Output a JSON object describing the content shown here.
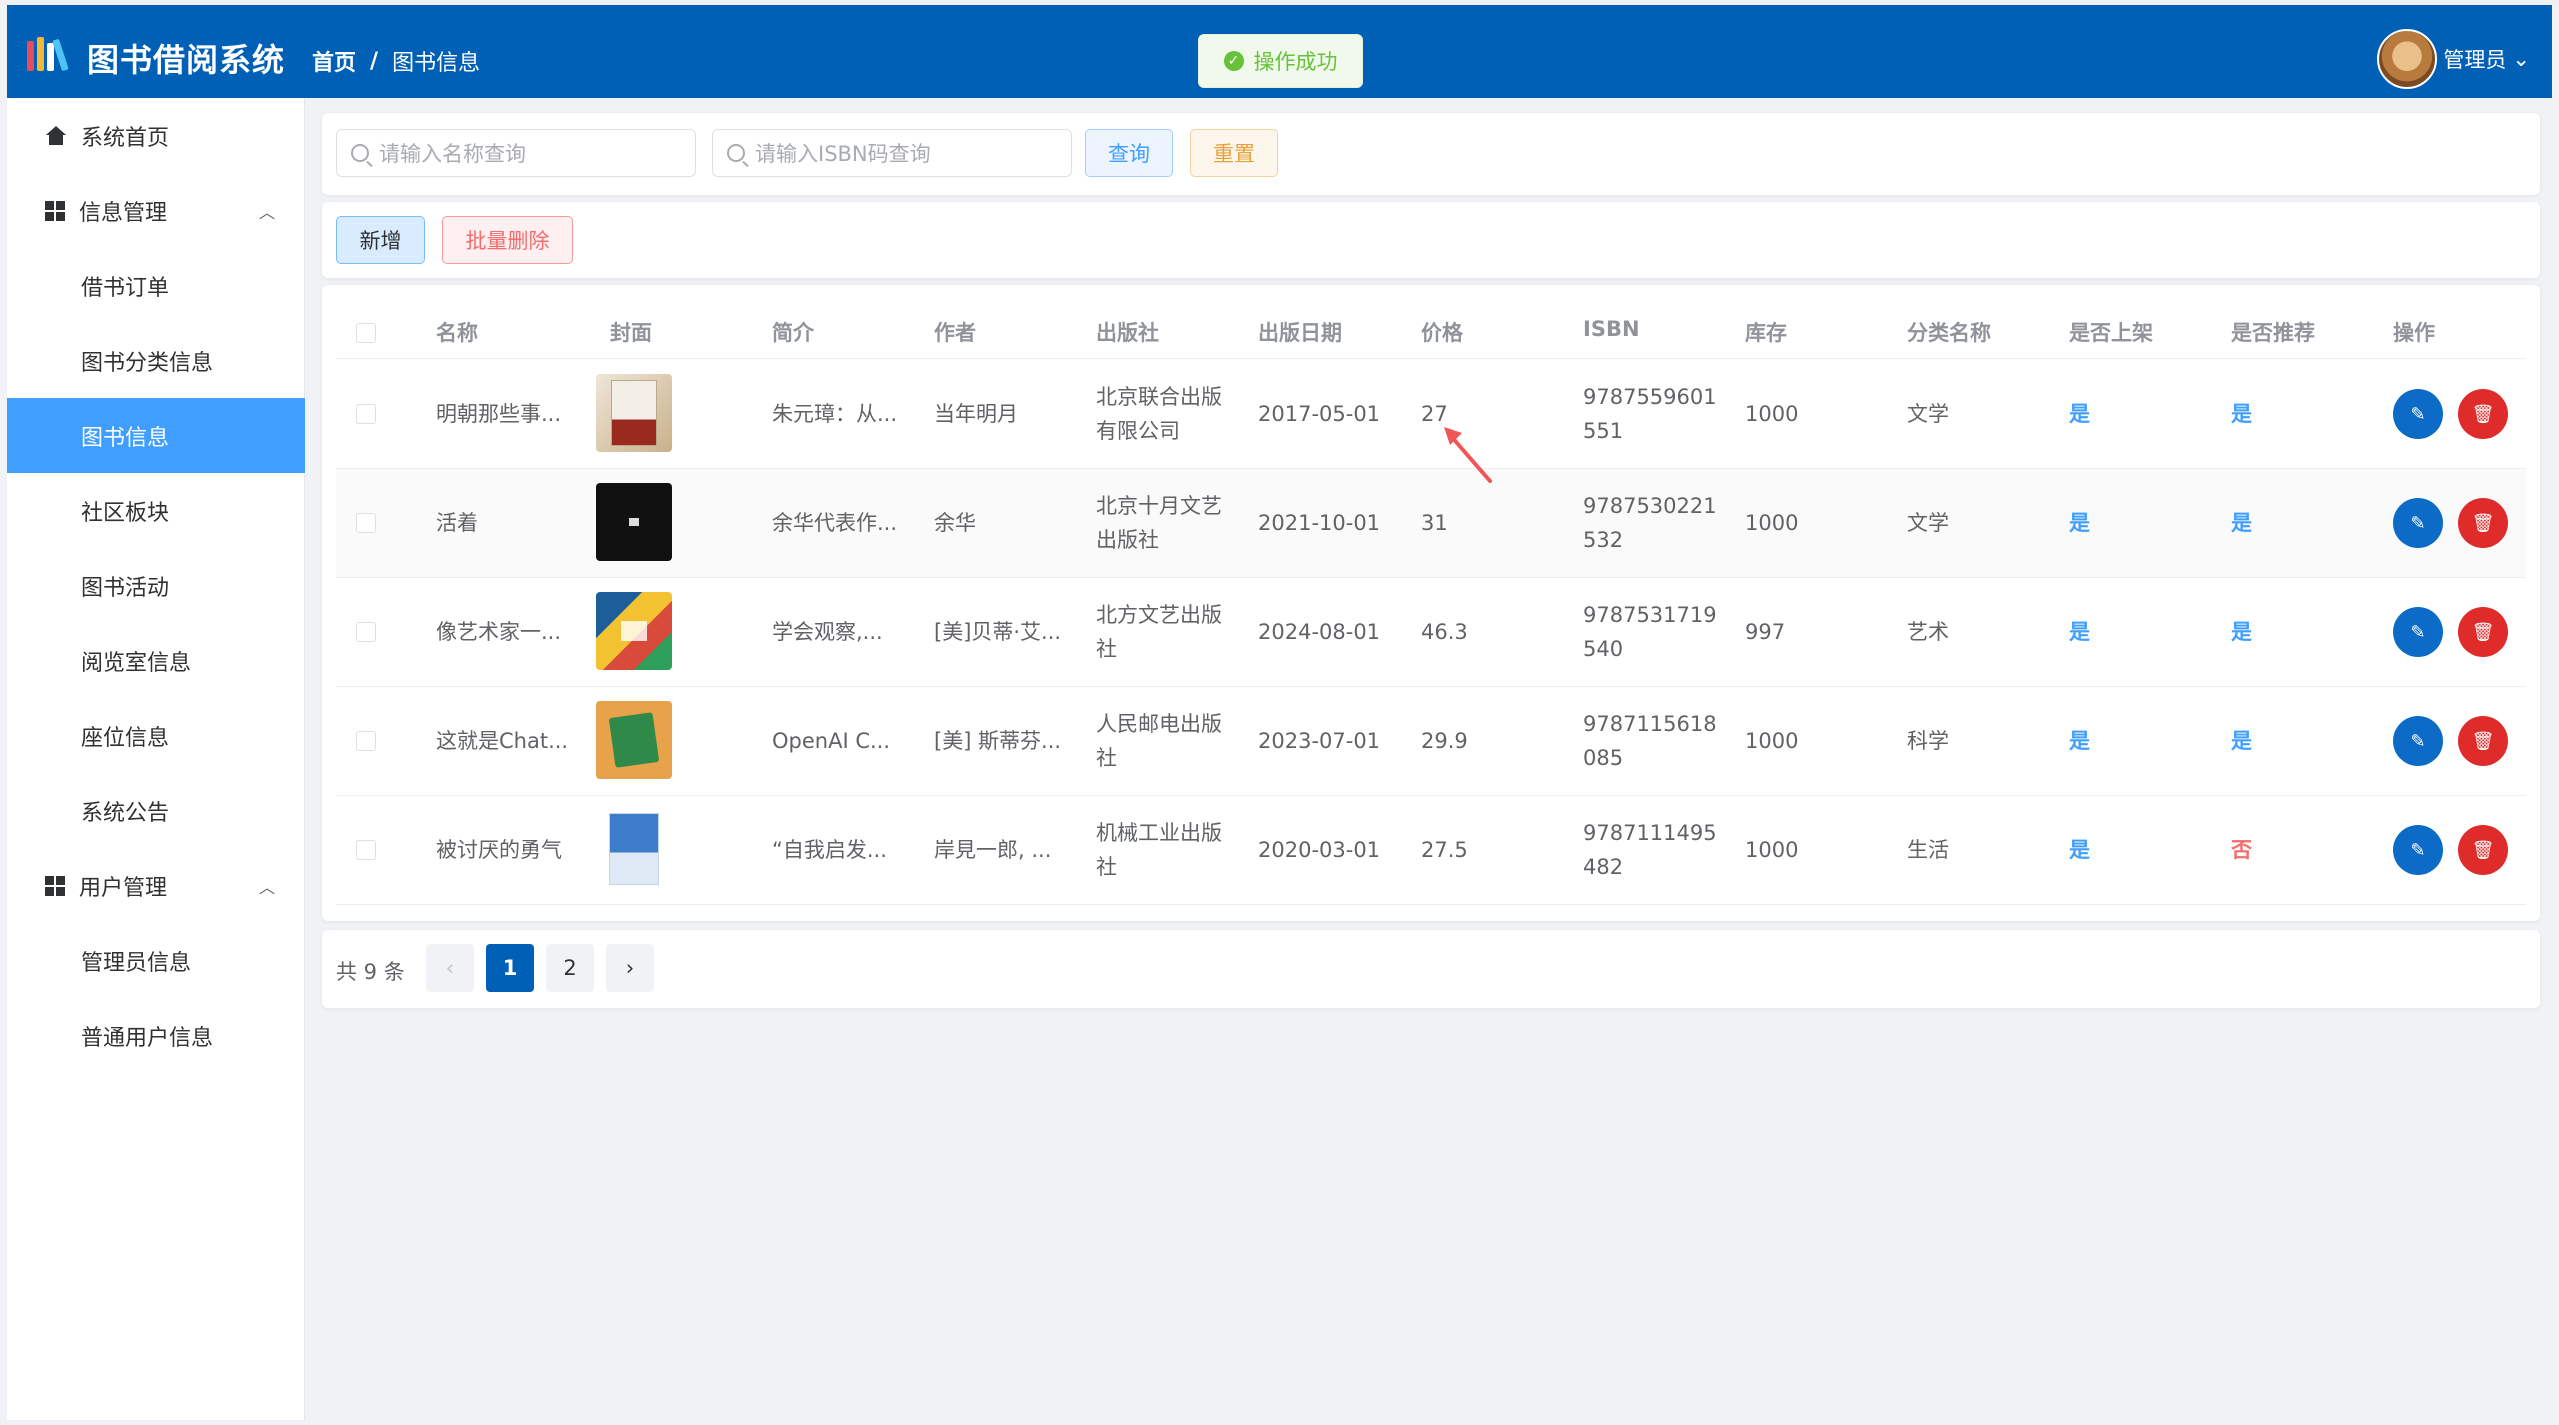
{
  "header": {
    "app_title": "图书借阅系统",
    "breadcrumb": {
      "home": "首页",
      "separator": "/",
      "current": "图书信息"
    },
    "user_name": "管理员"
  },
  "toast": {
    "text": "操作成功"
  },
  "sidebar": {
    "items": [
      {
        "label": "系统首页"
      },
      {
        "label": "信息管理"
      },
      {
        "label": "借书订单"
      },
      {
        "label": "图书分类信息"
      },
      {
        "label": "图书信息"
      },
      {
        "label": "社区板块"
      },
      {
        "label": "图书活动"
      },
      {
        "label": "阅览室信息"
      },
      {
        "label": "座位信息"
      },
      {
        "label": "系统公告"
      },
      {
        "label": "用户管理"
      },
      {
        "label": "管理员信息"
      },
      {
        "label": "普通用户信息"
      }
    ]
  },
  "search": {
    "name_placeholder": "请输入名称查询",
    "isbn_placeholder": "请输入ISBN码查询",
    "query_label": "查询",
    "reset_label": "重置"
  },
  "actions": {
    "add_label": "新增",
    "batch_delete_label": "批量删除"
  },
  "table": {
    "headers": [
      "名称",
      "封面",
      "简介",
      "作者",
      "出版社",
      "出版日期",
      "价格",
      "ISBN",
      "库存",
      "分类名称",
      "是否上架",
      "是否推荐",
      "操作"
    ],
    "rows": [
      {
        "name": "明朝那些事...",
        "intro": "朱元璋：从...",
        "author": "当年明月",
        "publisher": "北京联合出版有限公司",
        "date": "2017-05-01",
        "price": "27",
        "isbn1": "9787559601",
        "isbn2": "551",
        "stock": "1000",
        "category": "文学",
        "listed": "是",
        "recommended": "是"
      },
      {
        "name": "活着",
        "intro": "余华代表作...",
        "author": "余华",
        "publisher": "北京十月文艺出版社",
        "date": "2021-10-01",
        "price": "31",
        "isbn1": "9787530221",
        "isbn2": "532",
        "stock": "1000",
        "category": "文学",
        "listed": "是",
        "recommended": "是"
      },
      {
        "name": "像艺术家一...",
        "intro": "学会观察,...",
        "author": "[美]贝蒂·艾...",
        "publisher": "北方文艺出版社",
        "date": "2024-08-01",
        "price": "46.3",
        "isbn1": "9787531719",
        "isbn2": "540",
        "stock": "997",
        "category": "艺术",
        "listed": "是",
        "recommended": "是"
      },
      {
        "name": "这就是Chat...",
        "intro": "OpenAI C...",
        "author": "[美] 斯蒂芬...",
        "publisher": "人民邮电出版社",
        "date": "2023-07-01",
        "price": "29.9",
        "isbn1": "9787115618",
        "isbn2": "085",
        "stock": "1000",
        "category": "科学",
        "listed": "是",
        "recommended": "是"
      },
      {
        "name": "被讨厌的勇气",
        "intro": "“自我启发...",
        "author": "岸見一郎, ...",
        "publisher": "机械工业出版社",
        "date": "2020-03-01",
        "price": "27.5",
        "isbn1": "9787111495",
        "isbn2": "482",
        "stock": "1000",
        "category": "生活",
        "listed": "是",
        "recommended": "否"
      }
    ]
  },
  "pagination": {
    "total": "共 9 条",
    "pages": [
      "1",
      "2"
    ],
    "prev": "‹",
    "next": "›"
  },
  "colors": {
    "primary": "#0060b6",
    "active_menu": "#409eff",
    "success": "#67c23a",
    "danger": "#e02b2b"
  }
}
